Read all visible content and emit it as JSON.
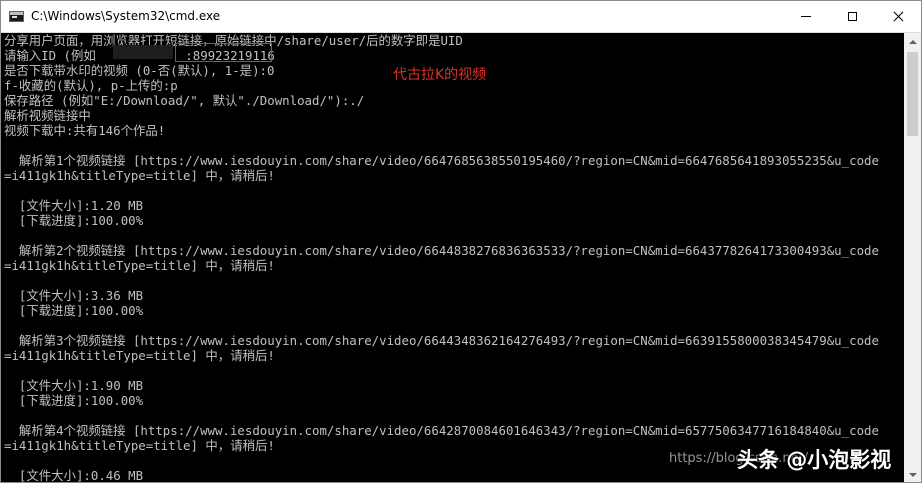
{
  "window": {
    "title": "C:\\Windows\\System32\\cmd.exe"
  },
  "console": {
    "lines": [
      "分享用户页面，用浏览器打开短链接，原始链接中/share/user/后的数字即是UID",
      "请输入ID (例如            :89923219116",
      "是否下载带水印的视频 (0-否(默认), 1-是):0",
      "f-收藏的(默认), p-上传的:p",
      "保存路径 (例如\"E:/Download/\", 默认\"./Download/\"):./",
      "解析视频链接中",
      "视频下载中:共有146个作品!",
      "",
      "  解析第1个视频链接 [https://www.iesdouyin.com/share/video/6647685638550195460/?region=CN&mid=6647685641893055235&u_code",
      "=i411gk1h&titleType=title] 中，请稍后!",
      "",
      "  [文件大小]:1.20 MB",
      "  [下载进度]:100.00%",
      "",
      "  解析第2个视频链接 [https://www.iesdouyin.com/share/video/6644838276836363533/?region=CN&mid=6643778264173300493&u_code",
      "=i411gk1h&titleType=title] 中，请稍后!",
      "",
      "  [文件大小]:3.36 MB",
      "  [下载进度]:100.00%",
      "",
      "  解析第3个视频链接 [https://www.iesdouyin.com/share/video/6644348362164276493/?region=CN&mid=6639155800038345479&u_code",
      "=i411gk1h&titleType=title] 中，请稍后!",
      "",
      "  [文件大小]:1.90 MB",
      "  [下载进度]:100.00%",
      "",
      "  解析第4个视频链接 [https://www.iesdouyin.com/share/video/6642870084601646343/?region=CN&mid=6577506347716184840&u_code",
      "=i411gk1h&titleType=title] 中，请稍后!",
      "",
      "  [文件大小]:0.46 MB"
    ]
  },
  "annotation": {
    "text": "代古拉K的视频",
    "color": "#e0302a"
  },
  "watermark": {
    "url_text": "https://blog.csdn.net/",
    "brand_text": "头条 @小泡影视"
  },
  "colors": {
    "console_bg": "#000000",
    "console_text": "#c0c0c0",
    "highlight_border": "#e0302a"
  },
  "icons": {
    "app": "cmd-icon",
    "minimize": "minimize-icon",
    "maximize": "maximize-icon",
    "close": "close-icon"
  },
  "scroll": {
    "position_fraction": 0.0
  }
}
